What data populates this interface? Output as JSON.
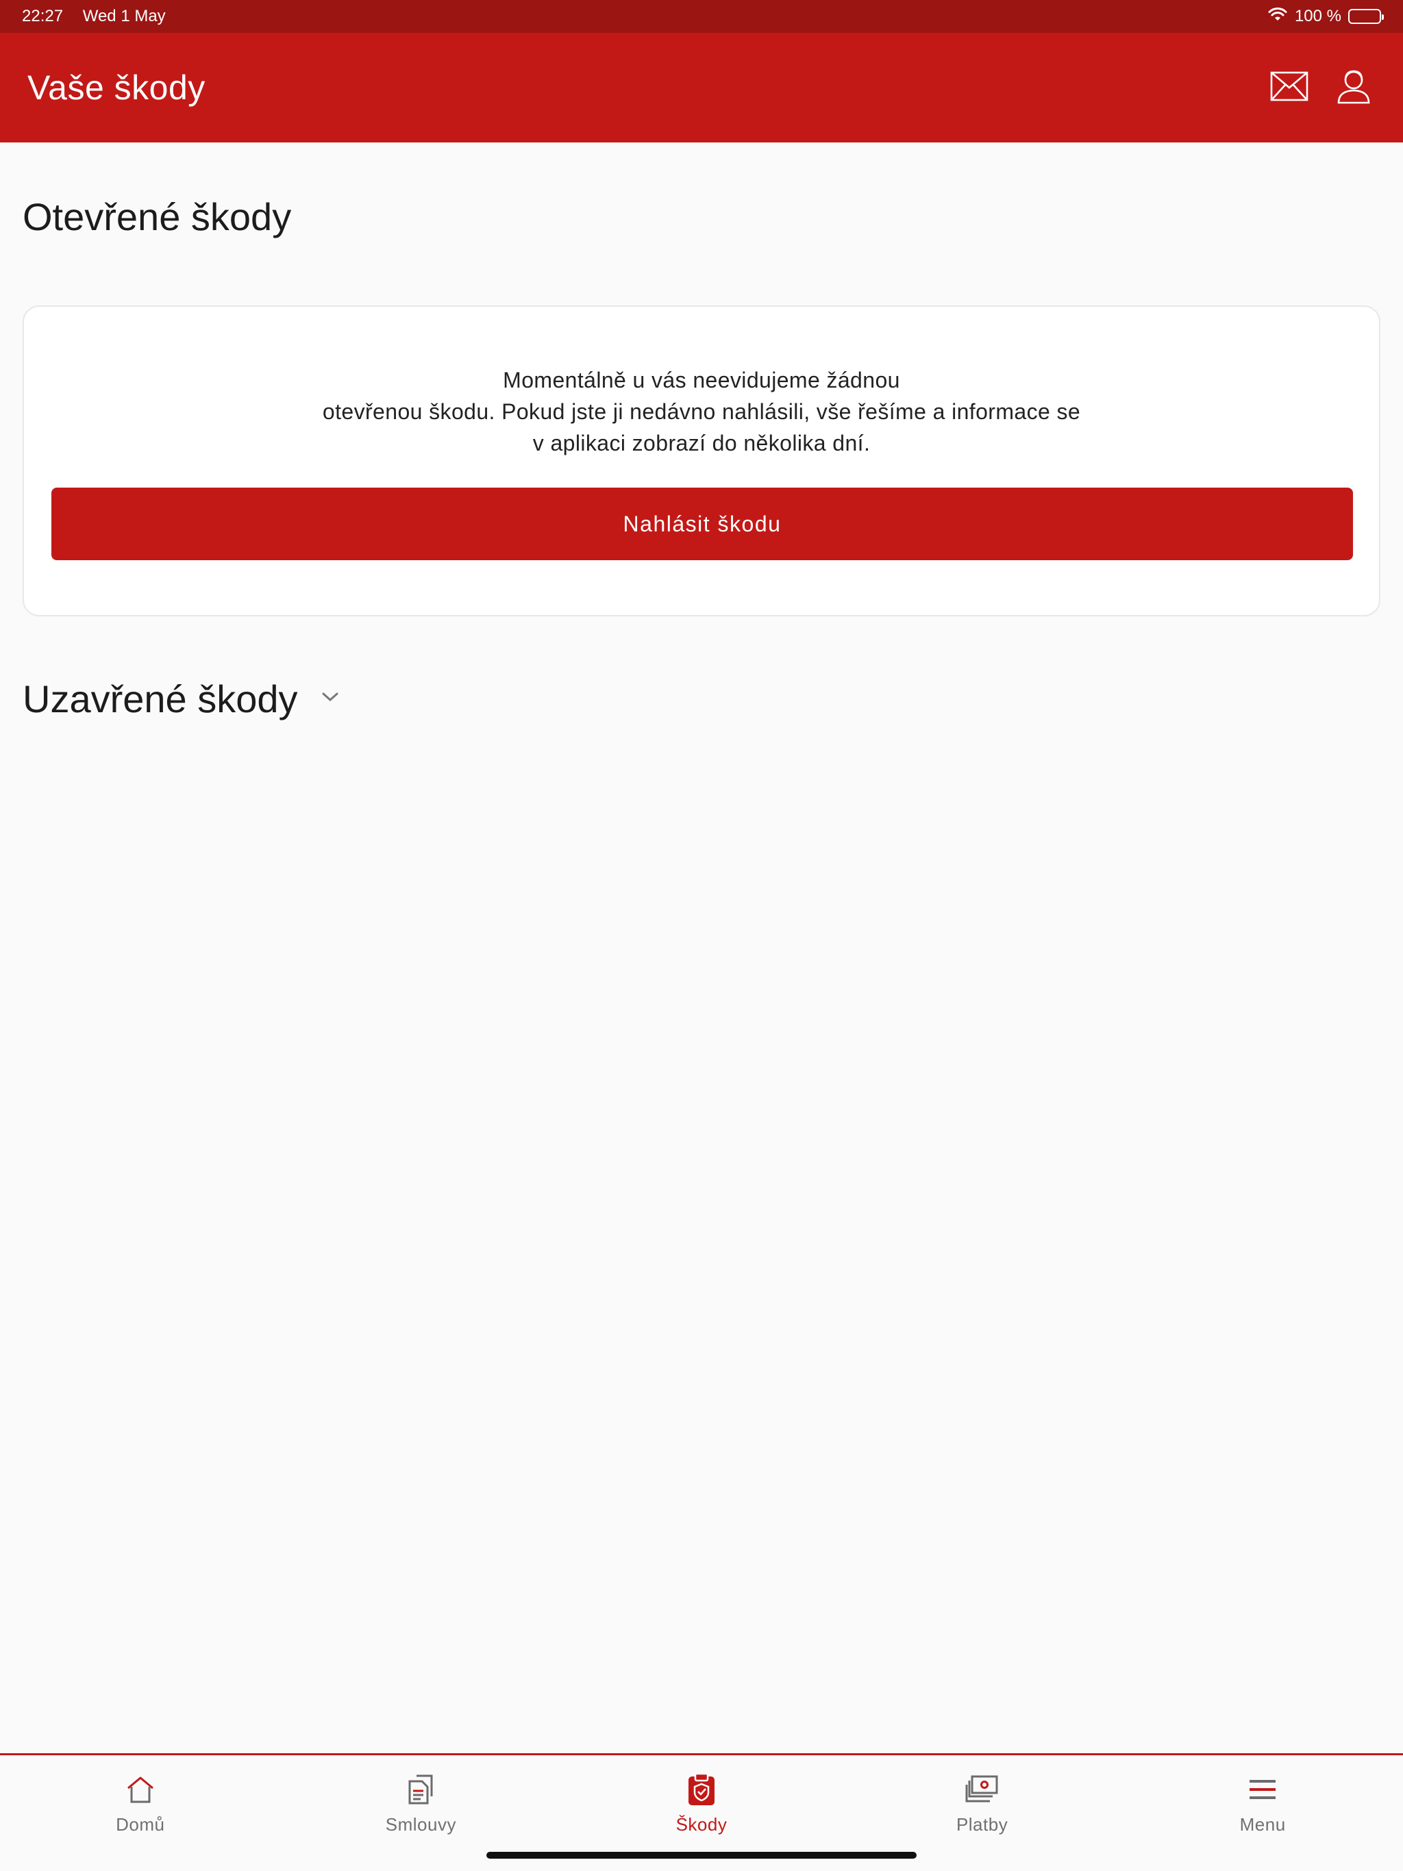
{
  "status_bar": {
    "time": "22:27",
    "date": "Wed 1 May",
    "battery_text": "100 %"
  },
  "header": {
    "title": "Vaše škody",
    "icons": [
      "envelope-icon",
      "user-icon"
    ]
  },
  "open_claims": {
    "title": "Otevřené škody",
    "message_lines": [
      "Momentálně u vás neevidujeme žádnou",
      "otevřenou škodu. Pokud jste ji nedávno nahlásili, vše řešíme a informace se",
      "v aplikaci zobrazí do několika dní."
    ],
    "report_button_label": "Nahlásit škodu"
  },
  "closed_claims": {
    "title": "Uzavřené škody",
    "expanded": false
  },
  "tab_bar": {
    "active_index": 2,
    "items": [
      {
        "label": "Domů",
        "icon": "home-icon"
      },
      {
        "label": "Smlouvy",
        "icon": "documents-icon"
      },
      {
        "label": "Škody",
        "icon": "claims-clipboard-icon"
      },
      {
        "label": "Platby",
        "icon": "payments-icon"
      },
      {
        "label": "Menu",
        "icon": "menu-icon"
      }
    ]
  },
  "colors": {
    "brand_red": "#c21917",
    "status_bar": "#9b1513",
    "inactive_tab": "#707070"
  }
}
